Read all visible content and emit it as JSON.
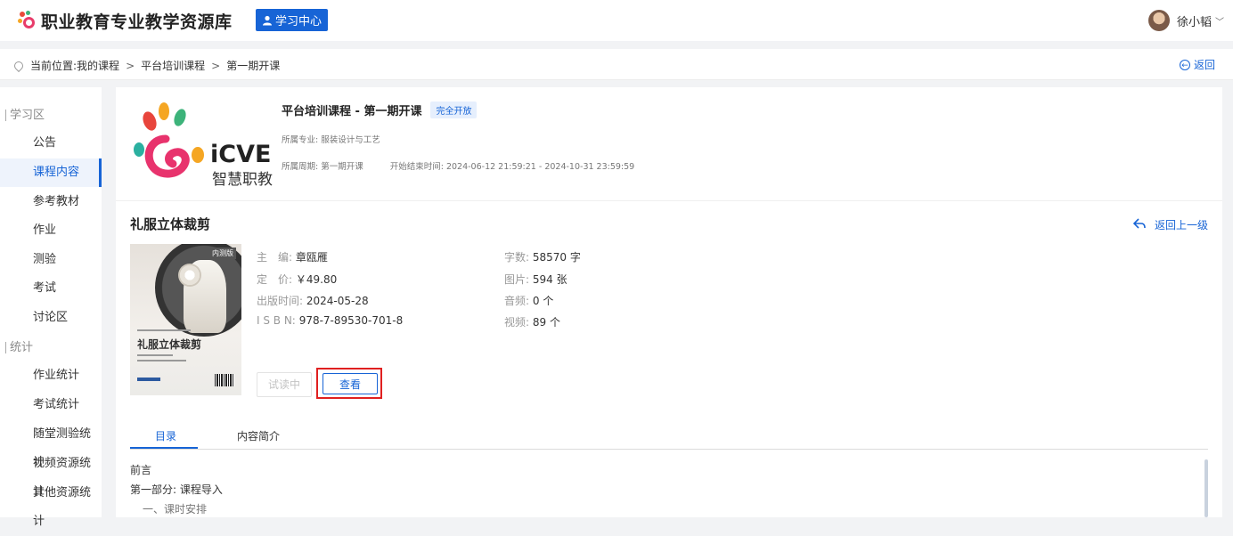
{
  "header": {
    "site_title": "职业教育专业教学资源库",
    "study_center": "学习中心",
    "user_name": "徐小韬"
  },
  "breadcrumb": {
    "prefix": "当前位置:",
    "items": [
      "我的课程",
      "平台培训课程",
      "第一期开课"
    ],
    "back": "返回"
  },
  "sidebar": {
    "group1": "学习区",
    "group1_items": [
      "公告",
      "课程内容",
      "参考教材",
      "作业",
      "测验",
      "考试",
      "讨论区"
    ],
    "group2": "统计",
    "group2_items": [
      "作业统计",
      "考试统计",
      "随堂测验统计",
      "视频资源统计",
      "其他资源统计"
    ],
    "active": "课程内容"
  },
  "course": {
    "logo_text": "iCVE",
    "logo_sub": "智慧职教",
    "title": "平台培训课程 - 第一期开课",
    "badge": "完全开放",
    "major": "所属专业: 服装设计与工艺",
    "period": "所属周期: 第一期开课",
    "time": "开始结束时间: 2024-06-12 21:59:21 - 2024-10-31 23:59:59"
  },
  "book": {
    "title": "礼服立体裁剪",
    "back_up": "返回上一级",
    "cover_tag": "内测版",
    "cover_title": "礼服立体裁剪",
    "editor_label": "主　编:",
    "editor": "章瓯雁",
    "price_label": "定　价:",
    "price": "￥49.80",
    "pubdate_label": "出版时间:",
    "pubdate": "2024-05-28",
    "isbn_label": "I S B N:",
    "isbn": "978-7-89530-701-8",
    "words_label": "字数:",
    "words": "58570 字",
    "images_label": "图片:",
    "images": "594 张",
    "audio_label": "音频:",
    "audio": "0 个",
    "video_label": "视频:",
    "video": "89 个",
    "try_btn": "试读中",
    "view_btn": "查看"
  },
  "tabs": [
    "目录",
    "内容简介"
  ],
  "toc": [
    "前言",
    "第一部分: 课程导入",
    "一、课时安排"
  ]
}
